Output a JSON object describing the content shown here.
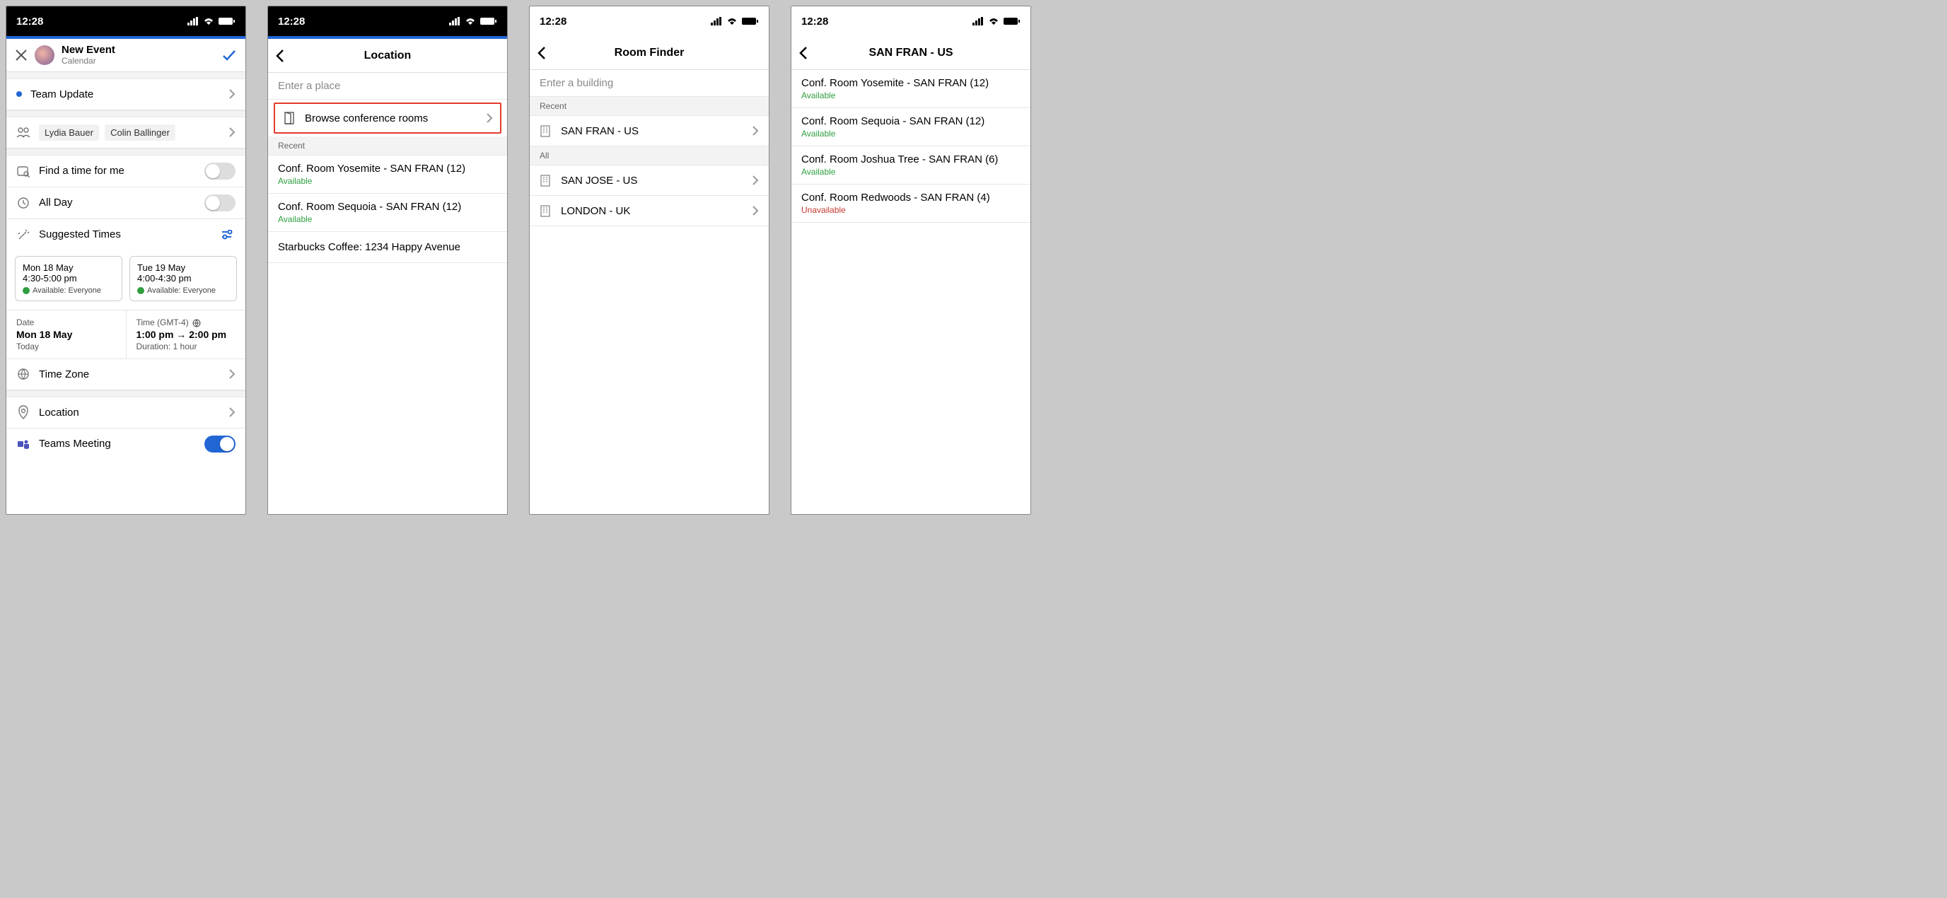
{
  "global": {
    "time": "12:28"
  },
  "screen1": {
    "header": {
      "title": "New Event",
      "subtitle": "Calendar"
    },
    "eventTitle": "Team Update",
    "people": [
      "Lydia Bauer",
      "Colin Ballinger"
    ],
    "findTime": "Find a time for me",
    "allDay": "All Day",
    "suggested": {
      "label": "Suggested Times",
      "cards": [
        {
          "date": "Mon 18 May",
          "time": "4:30-5:00 pm",
          "avail": "Available: Everyone"
        },
        {
          "date": "Tue 19 May",
          "time": "4:00-4:30 pm",
          "avail": "Available: Everyone"
        }
      ]
    },
    "dateLabel": "Date",
    "dateValue": "Mon 18 May",
    "dateSub": "Today",
    "timeLabel": "Time (GMT-4)",
    "timeFrom": "1:00 pm",
    "timeTo": "2:00 pm",
    "durationLabel": "Duration: 1 hour",
    "timezone": "Time Zone",
    "location": "Location",
    "teams": "Teams Meeting"
  },
  "screen2": {
    "title": "Location",
    "placeholder": "Enter a place",
    "browse": "Browse conference rooms",
    "recentLabel": "Recent",
    "rooms": [
      {
        "name": "Conf. Room Yosemite - SAN FRAN (12)",
        "status": "Available"
      },
      {
        "name": "Conf. Room Sequoia - SAN FRAN (12)",
        "status": "Available"
      }
    ],
    "place": "Starbucks Coffee: 1234 Happy Avenue"
  },
  "screen3": {
    "title": "Room Finder",
    "placeholder": "Enter a building",
    "recentLabel": "Recent",
    "allLabel": "All",
    "recent": [
      "SAN FRAN - US"
    ],
    "all": [
      "SAN JOSE - US",
      "LONDON - UK"
    ]
  },
  "screen4": {
    "title": "SAN FRAN - US",
    "rooms": [
      {
        "name": "Conf. Room Yosemite - SAN FRAN (12)",
        "status": "Available",
        "ok": true
      },
      {
        "name": "Conf. Room Sequoia - SAN FRAN (12)",
        "status": "Available",
        "ok": true
      },
      {
        "name": "Conf. Room Joshua Tree - SAN FRAN (6)",
        "status": "Available",
        "ok": true
      },
      {
        "name": "Conf. Room Redwoods - SAN FRAN (4)",
        "status": "Unavailable",
        "ok": false
      }
    ]
  }
}
